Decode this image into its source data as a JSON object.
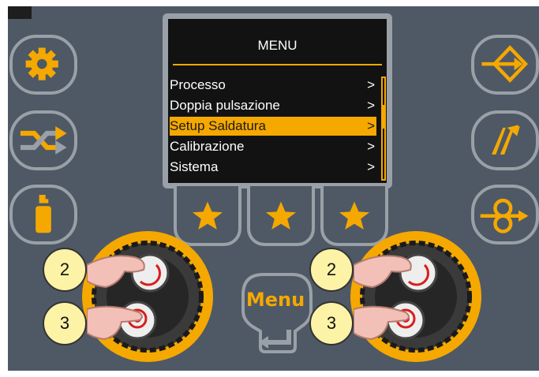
{
  "menu": {
    "title": "MENU",
    "items": [
      {
        "label": "Processo",
        "arrow": ">",
        "selected": false
      },
      {
        "label": "Doppia pulsazione",
        "arrow": ">",
        "selected": false
      },
      {
        "label": "Setup Saldatura",
        "arrow": ">",
        "selected": true
      },
      {
        "label": "Calibrazione",
        "arrow": ">",
        "selected": false
      },
      {
        "label": "Sistema",
        "arrow": ">",
        "selected": false
      }
    ]
  },
  "left_buttons": [
    {
      "icon": "gear-icon"
    },
    {
      "icon": "shuffle-icon"
    },
    {
      "icon": "spray-bottle-icon"
    }
  ],
  "right_buttons": [
    {
      "icon": "arrow-diamond-icon"
    },
    {
      "icon": "double-slash-arrows-icon"
    },
    {
      "icon": "wire-feed-icon"
    }
  ],
  "favorite_buttons": [
    {
      "icon": "star-icon"
    },
    {
      "icon": "star-icon"
    },
    {
      "icon": "star-icon"
    }
  ],
  "menu_button": {
    "label": "Menu",
    "icon": "back-arrow-icon"
  },
  "callouts": {
    "left_top": "2",
    "left_bottom": "3",
    "right_top": "2",
    "right_bottom": "3"
  },
  "colors": {
    "panel": "#4e5965",
    "accent": "#f5a800",
    "bezel": "#9aa0a7",
    "screen": "#121212"
  }
}
